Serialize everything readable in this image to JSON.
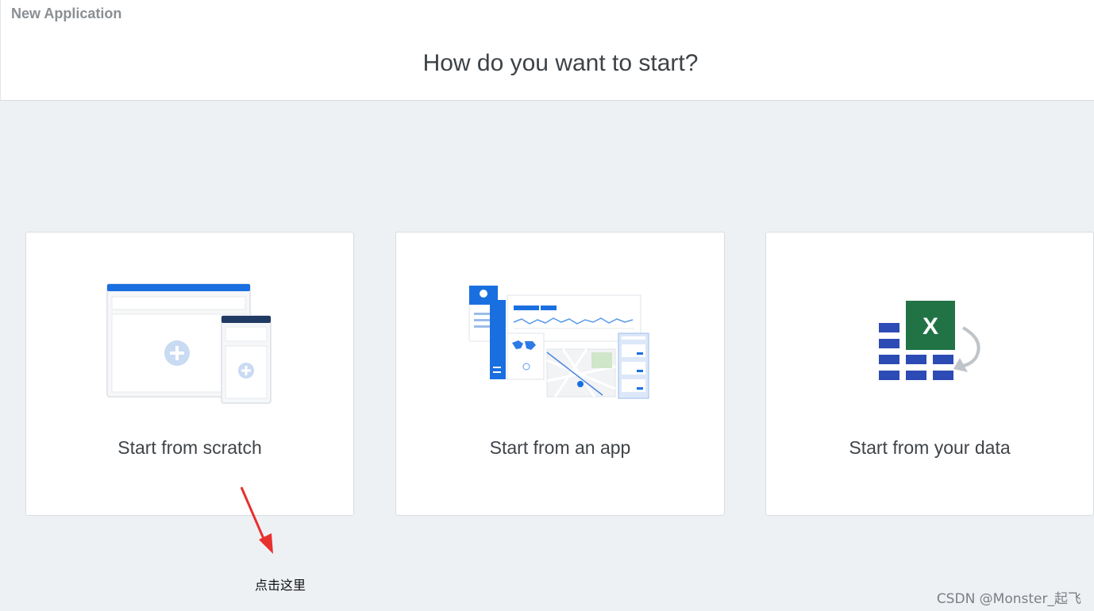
{
  "header": {
    "app_title": "New Application",
    "question": "How do you want to start?"
  },
  "options": [
    {
      "label": "Start from scratch",
      "icon": "blank-app-layout-icon"
    },
    {
      "label": "Start from an app",
      "icon": "sample-app-dashboard-icon"
    },
    {
      "label": "Start from your data",
      "icon": "excel-import-icon"
    }
  ],
  "annotation": {
    "text": "点击这里",
    "arrow_color": "#e8302e"
  },
  "watermark": "CSDN @Monster_起飞",
  "colors": {
    "accent_blue": "#1a6fe0",
    "navy": "#203a63",
    "excel_green": "#217346",
    "grid_blue": "#2f3ea8"
  }
}
